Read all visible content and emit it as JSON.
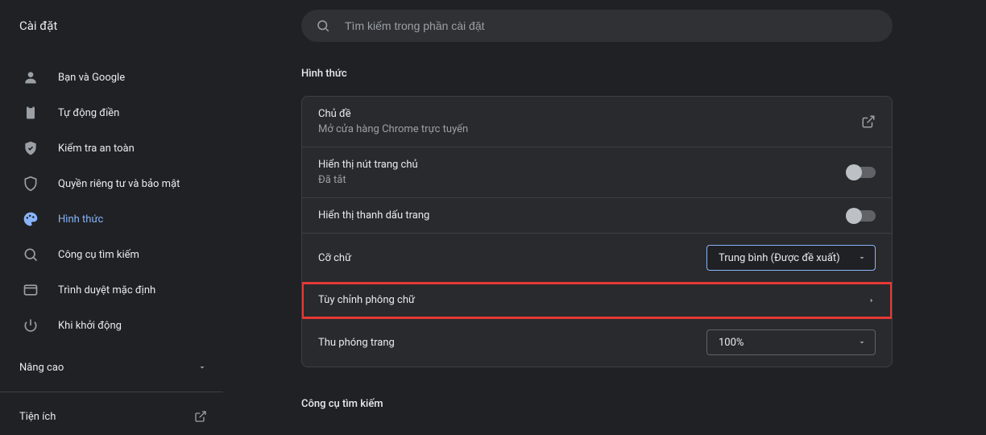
{
  "app_title": "Cài đặt",
  "search": {
    "placeholder": "Tìm kiếm trong phần cài đặt"
  },
  "sidebar": {
    "items": [
      {
        "label": "Bạn và Google"
      },
      {
        "label": "Tự động điền"
      },
      {
        "label": "Kiểm tra an toàn"
      },
      {
        "label": "Quyền riêng tư và bảo mật"
      },
      {
        "label": "Hình thức"
      },
      {
        "label": "Công cụ tìm kiếm"
      },
      {
        "label": "Trình duyệt mặc định"
      },
      {
        "label": "Khi khởi động"
      }
    ],
    "advanced": "Nâng cao",
    "extensions": "Tiện ích"
  },
  "main": {
    "section_title": "Hình thức",
    "theme": {
      "title": "Chủ đề",
      "subtitle": "Mở cửa hàng Chrome trực tuyến"
    },
    "home_button": {
      "title": "Hiển thị nút trang chủ",
      "subtitle": "Đã tắt"
    },
    "bookmark_bar": {
      "title": "Hiển thị thanh dấu trang"
    },
    "font_size": {
      "title": "Cỡ chữ",
      "value": "Trung bình (Được đề xuất)"
    },
    "customize_fonts": {
      "title": "Tùy chỉnh phông chữ"
    },
    "page_zoom": {
      "title": "Thu phóng trang",
      "value": "100%"
    },
    "next_section_title": "Công cụ tìm kiếm"
  }
}
